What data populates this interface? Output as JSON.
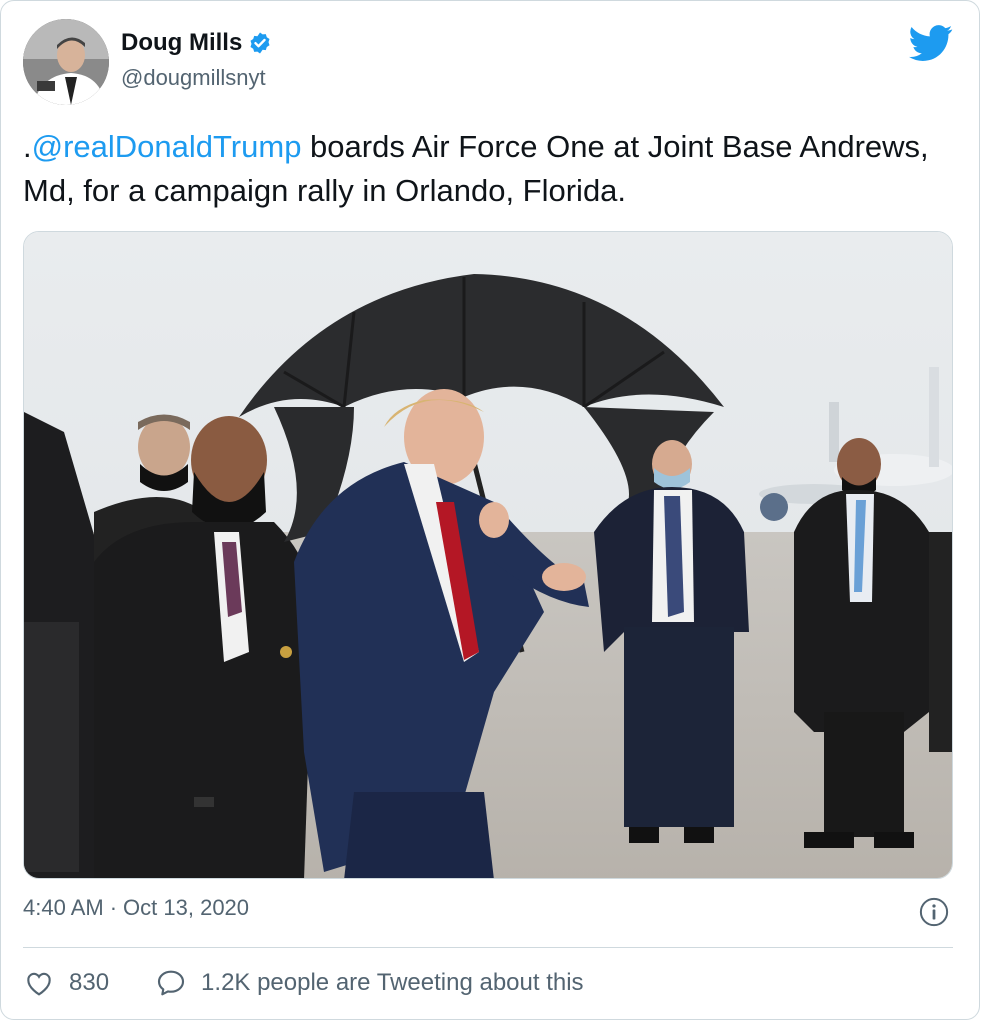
{
  "tweet": {
    "author": {
      "display_name": "Doug Mills",
      "handle": "@dougmillsnyt",
      "verified": true
    },
    "text": {
      "prefix": ".",
      "mention": "@realDonaldTrump",
      "body": " boards Air Force One at Joint Base Andrews, Md, for a campaign rally in Orlando, Florida."
    },
    "timestamp": {
      "time": "4:40 AM",
      "separator": "·",
      "date": "Oct 13, 2020"
    },
    "actions": {
      "like_count": "830",
      "conversation_label": "1.2K people are Tweeting about this"
    }
  },
  "icons": {
    "brand": "twitter-bird-icon",
    "verified": "verified-badge-icon",
    "info": "info-icon",
    "like": "heart-icon",
    "reply": "speech-bubble-icon"
  },
  "colors": {
    "brand_blue": "#1d9bf0",
    "text_primary": "#0f1419",
    "text_secondary": "#536471",
    "border": "#cfd9de"
  }
}
